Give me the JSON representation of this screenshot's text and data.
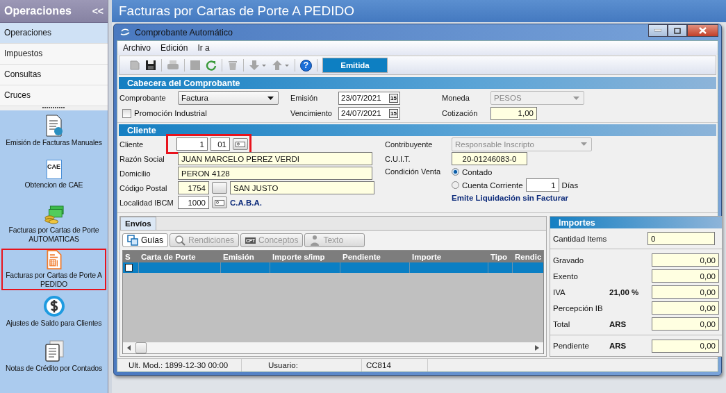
{
  "page_title": "Facturas por Cartas de Porte A PEDIDO",
  "sidebar": {
    "title": "Operaciones",
    "collapse": "<<",
    "groups": [
      {
        "label": "Operaciones",
        "selected": true
      },
      {
        "label": "Impuestos",
        "selected": false
      },
      {
        "label": "Consultas",
        "selected": false
      },
      {
        "label": "Cruces",
        "selected": false
      }
    ],
    "items": [
      {
        "kind": "invoice",
        "label": "Emisión de Facturas Manuales",
        "highlighted": false
      },
      {
        "kind": "certificate",
        "icon_text": "CAE",
        "label": "Obtencion de CAE",
        "highlighted": false
      },
      {
        "kind": "money",
        "label": "Facturas por Cartas de Porte AUTOMATICAS",
        "highlighted": false
      },
      {
        "kind": "calculator",
        "label": "Facturas por Cartas de Porte A PEDIDO",
        "highlighted": true
      },
      {
        "kind": "exchange",
        "label": "Ajustes de Saldo para Clientes",
        "highlighted": false
      },
      {
        "kind": "notes",
        "label": "Notas de Crédito por Contados",
        "highlighted": false
      }
    ]
  },
  "dialog": {
    "title": "Comprobante Automático",
    "menu": [
      "Archivo",
      "Edición",
      "Ir a"
    ],
    "toolbar": {
      "help": "?",
      "status": "Emitida"
    },
    "cabecera": {
      "title": "Cabecera del Comprobante",
      "comprobante": {
        "label": "Comprobante",
        "value": "Factura"
      },
      "emision": {
        "label": "Emisión",
        "value": "23/07/2021",
        "button": "15"
      },
      "moneda": {
        "label": "Moneda",
        "value": "PESOS",
        "disabled": true
      },
      "promocion": {
        "label": "Promoción Industrial",
        "checked": false
      },
      "vencimiento": {
        "label": "Vencimiento",
        "value": "24/07/2021",
        "button": "15"
      },
      "cotizacion": {
        "label": "Cotización",
        "value": "1,00"
      }
    },
    "cliente": {
      "title": "Cliente",
      "cliente": {
        "label": "Cliente",
        "number": "1",
        "branch": "01",
        "highlighted": true
      },
      "razon_social": {
        "label": "Razón Social",
        "value": "JUAN MARCELO PEREZ VERDI"
      },
      "domicilio": {
        "label": "Domicilio",
        "value": "PERON 4128"
      },
      "codigo_postal": {
        "label": "Código Postal",
        "code": "1754",
        "city": "SAN JUSTO"
      },
      "localidad": {
        "label": "Localidad IBCM",
        "code": "1000",
        "name": "C.A.B.A."
      },
      "contribuyente": {
        "label": "Contribuyente",
        "value": "Responsable Inscripto",
        "disabled": true
      },
      "cuit": {
        "label": "C.U.I.T.",
        "value": "20-01246083-0"
      },
      "condicion_venta": {
        "label": "Condición Venta",
        "options": [
          {
            "label": "Contado",
            "selected": true
          },
          {
            "label": "Cuenta Corriente",
            "selected": false
          }
        ],
        "days": "1",
        "days_label": "Días"
      },
      "note": "Emite Liquidación sin Facturar"
    },
    "envios": {
      "tabs": [
        {
          "label": "Envíos",
          "selected": true
        }
      ],
      "subtabs": [
        {
          "kind": "guides",
          "label": "Guías",
          "selected": true,
          "disabled": false
        },
        {
          "kind": "search",
          "label": "Rendiciones",
          "selected": false,
          "disabled": true
        },
        {
          "kind": "box",
          "icon_text": "CPT",
          "label": "Conceptos",
          "selected": false,
          "disabled": true
        },
        {
          "kind": "person",
          "label": "Texto",
          "selected": false,
          "disabled": true
        }
      ],
      "table": {
        "columns": [
          "S",
          "Carta de Porte",
          "Emisión",
          "Importe s/imp",
          "Pendiente",
          "Importe",
          "Tipo",
          "Rendic"
        ],
        "rows": [
          {
            "selected": true,
            "checked": false
          }
        ]
      }
    },
    "importes": {
      "title": "Importes",
      "cantidad": {
        "label": "Cantidad Items",
        "value": "0"
      },
      "rows": [
        {
          "label": "Gravado",
          "value": "0,00"
        },
        {
          "label": "Exento",
          "value": "0,00"
        },
        {
          "label": "IVA",
          "extra": "21,00 %",
          "value": "0,00"
        },
        {
          "label": "Percepción IB",
          "value": "0,00"
        },
        {
          "label": "Total",
          "extra": "ARS",
          "value": "0,00"
        }
      ],
      "pendiente": {
        "label": "Pendiente",
        "extra": "ARS",
        "value": "0,00"
      }
    },
    "status_bar": [
      "Ult. Mod.: 1899-12-30 00:00",
      "Usuario:",
      "CC814"
    ]
  }
}
